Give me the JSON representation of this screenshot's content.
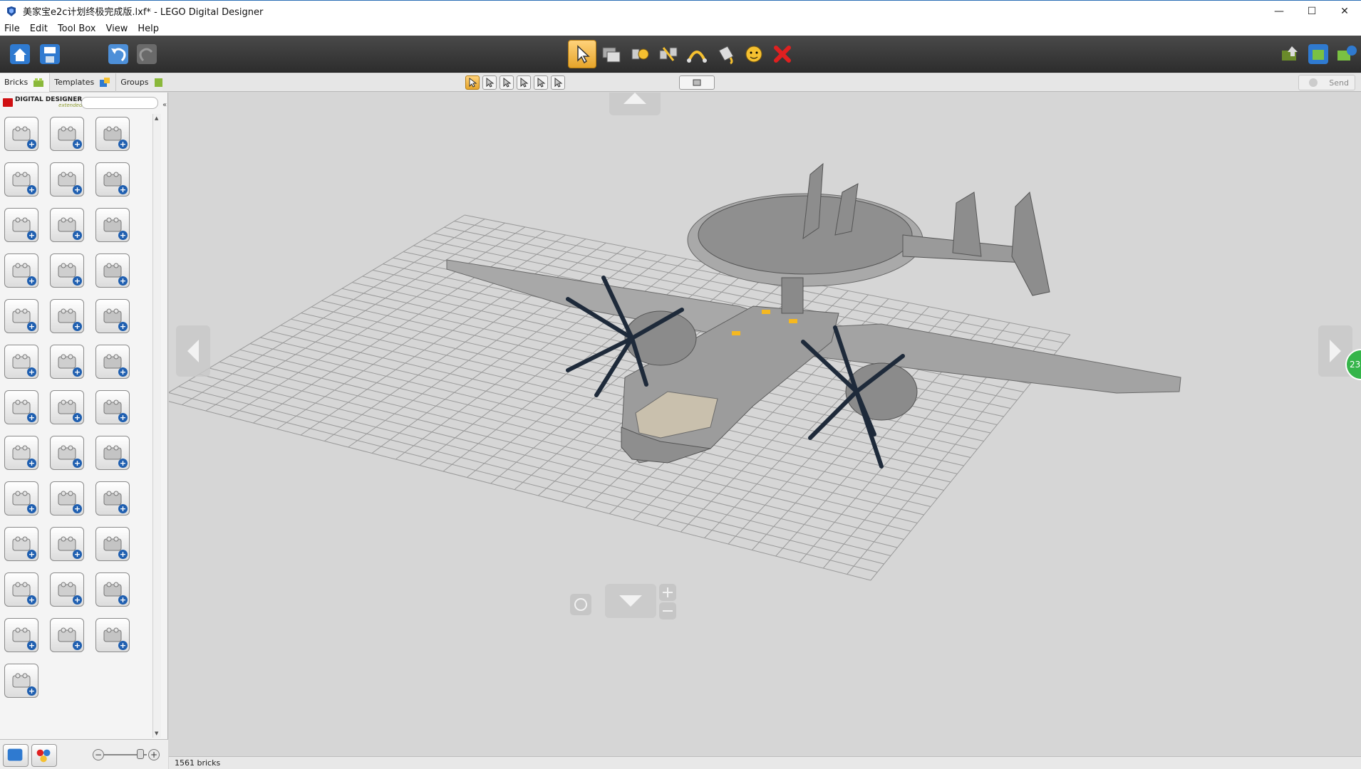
{
  "window": {
    "title": "美家宝e2c计划终极完成版.lxf* - LEGO Digital Designer",
    "minimize": "—",
    "maximize": "☐",
    "close": "✕"
  },
  "menu": [
    "File",
    "Edit",
    "Tool Box",
    "View",
    "Help"
  ],
  "tabs": [
    "Bricks",
    "Templates",
    "Groups"
  ],
  "palette": {
    "brand_text": "DIGITAL DESIGNER",
    "brand_sub": "extended",
    "search_value": ""
  },
  "subbar": {
    "send_label": "Send"
  },
  "viewport": {
    "badge_text": "23"
  },
  "status": {
    "brick_count": "1561 bricks"
  },
  "colors": {
    "toolbar": "#333333",
    "active": "#e6a52b",
    "accent_blue": "#1f5fb0",
    "badge_green": "#35b54a"
  }
}
